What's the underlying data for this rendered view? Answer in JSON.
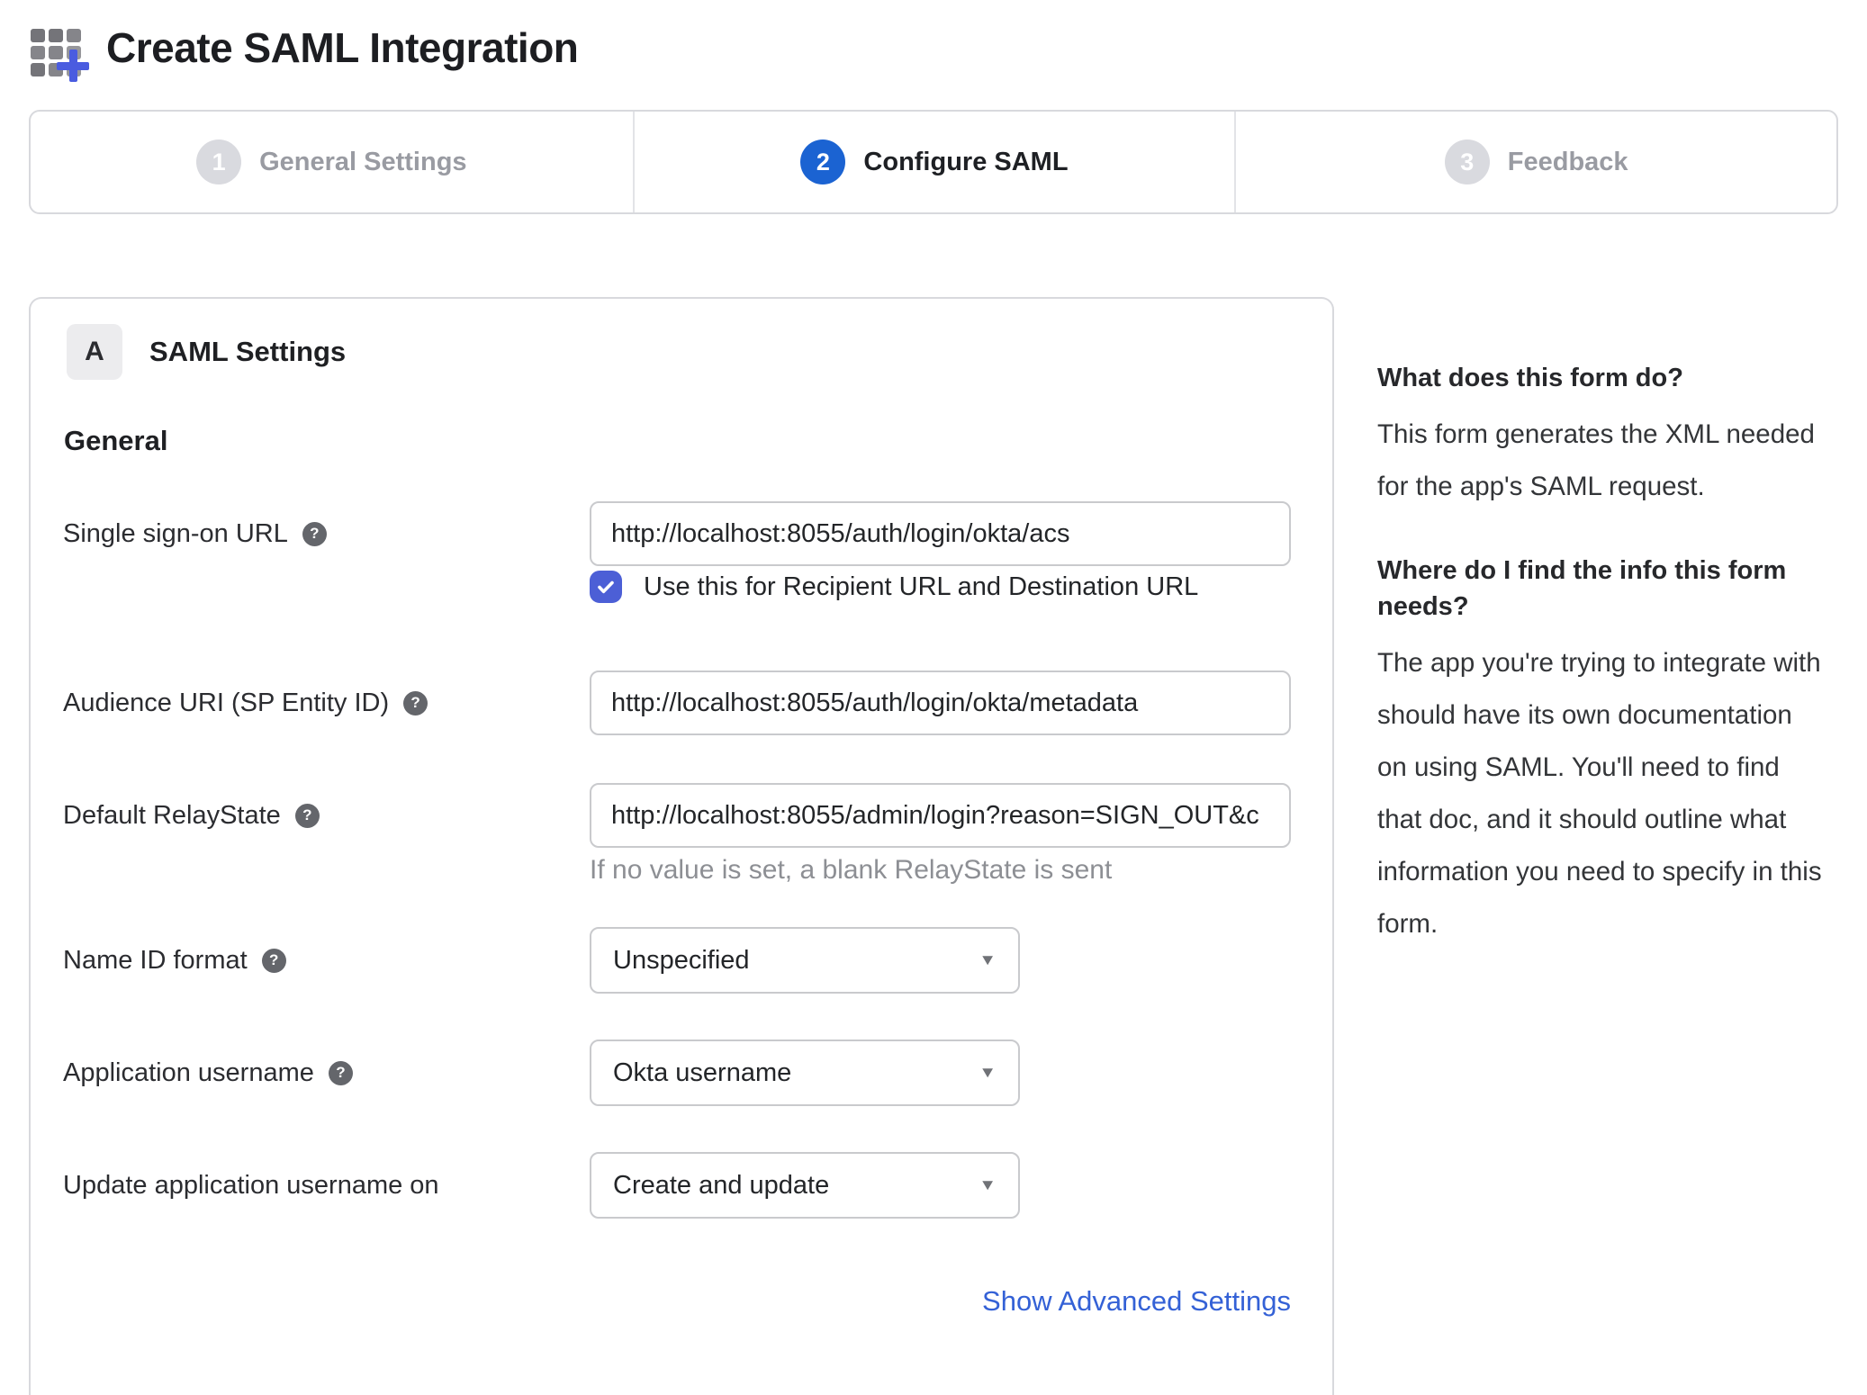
{
  "page": {
    "title": "Create SAML Integration"
  },
  "steps": [
    {
      "number": "1",
      "label": "General Settings",
      "state": "inactive"
    },
    {
      "number": "2",
      "label": "Configure SAML",
      "state": "active"
    },
    {
      "number": "3",
      "label": "Feedback",
      "state": "inactive"
    }
  ],
  "panel": {
    "badge": "A",
    "section_title": "SAML Settings",
    "subsection_title": "General",
    "fields": [
      {
        "label": "Single sign-on URL",
        "type": "text",
        "value": "http://localhost:8055/auth/login/okta/acs",
        "checkbox_checked": true,
        "checkbox_label": "Use this for Recipient URL and Destination URL"
      },
      {
        "label": "Audience URI (SP Entity ID)",
        "type": "text",
        "value": "http://localhost:8055/auth/login/okta/metadata"
      },
      {
        "label": "Default RelayState",
        "type": "text",
        "value": "http://localhost:8055/admin/login?reason=SIGN_OUT&c",
        "helper": "If no value is set, a blank RelayState is sent"
      },
      {
        "label": "Name ID format",
        "type": "select",
        "value": "Unspecified"
      },
      {
        "label": "Application username",
        "type": "select",
        "value": "Okta username"
      },
      {
        "label": "Update application username on",
        "type": "select",
        "value": "Create and update"
      }
    ],
    "advanced_link": "Show Advanced Settings"
  },
  "sidebar": {
    "blocks": [
      {
        "heading": "What does this form do?",
        "body": "This form generates the XML needed for the app's SAML request."
      },
      {
        "heading": "Where do I find the info this form needs?",
        "body": "The app you're trying to integrate with should have its own documentation on using SAML. You'll need to find that doc, and it should outline what information you need to specify in this form."
      }
    ]
  },
  "ui": {
    "help_glyph": "?",
    "dropdown_arrow_glyph": "▼"
  },
  "colors": {
    "step_active": "#1b63d2",
    "checkbox": "#4c5fd6",
    "link": "#3461d6",
    "plus_icon": "#4a5ce0",
    "border": "#d8d9dd",
    "input_border": "#c9cacd"
  }
}
